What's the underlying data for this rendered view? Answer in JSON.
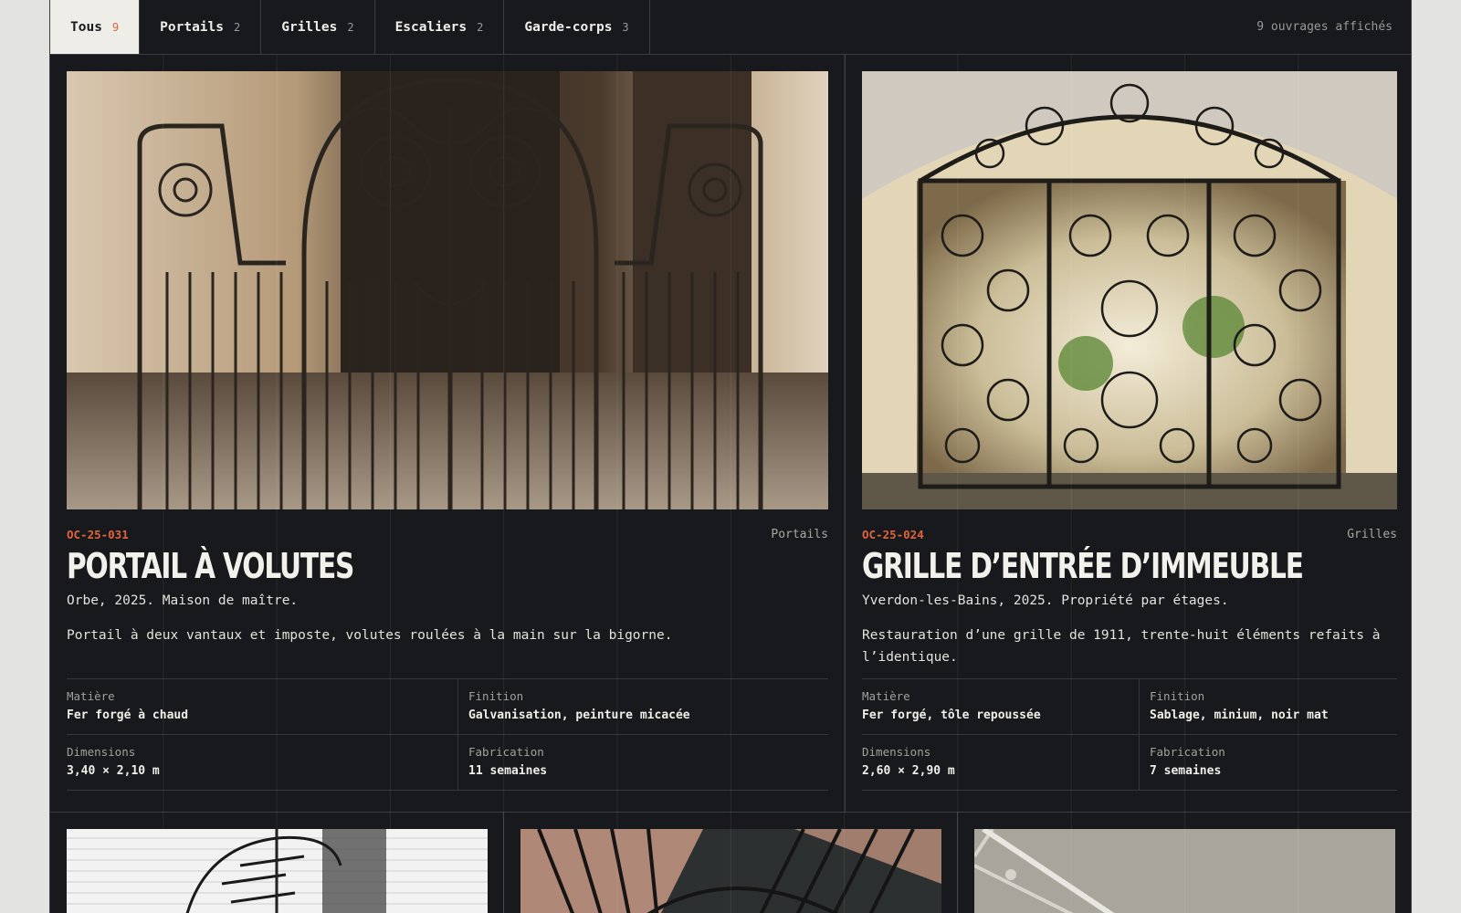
{
  "tabs": [
    {
      "label": "Tous",
      "count": "9",
      "active": true
    },
    {
      "label": "Portails",
      "count": "2"
    },
    {
      "label": "Grilles",
      "count": "2"
    },
    {
      "label": "Escaliers",
      "count": "2"
    },
    {
      "label": "Garde-corps",
      "count": "3"
    }
  ],
  "summary": "9 ouvrages affichés",
  "cards": [
    {
      "ref": "OC-25-031",
      "category": "Portails",
      "title": "PORTAIL À VOLUTES",
      "location": "Orbe, 2025. Maison de maître.",
      "description": "Portail à deux vantaux et imposte, volutes roulées à la main sur la bigorne.",
      "image": "wrought-iron-gate-photo",
      "specs": {
        "material_label": "Matière",
        "material": "Fer forgé à chaud",
        "finish_label": "Finition",
        "finish": "Galvanisation, peinture micacée",
        "dimensions_label": "Dimensions",
        "dimensions": "3,40 × 2,10 m",
        "fabrication_label": "Fabrication",
        "fabrication": "11 semaines"
      }
    },
    {
      "ref": "OC-25-024",
      "category": "Grilles",
      "title": "GRILLE D’ENTRÉE D’IMMEUBLE",
      "location": "Yverdon-les-Bains, 2025. Propriété par étages.",
      "description": "Restauration d’une grille de 1911, trente-huit éléments refaits à l’identique.",
      "image": "ornate-entrance-grille-photo",
      "specs": {
        "material_label": "Matière",
        "material": "Fer forgé, tôle repoussée",
        "finish_label": "Finition",
        "finish": "Sablage, minium, noir mat",
        "dimensions_label": "Dimensions",
        "dimensions": "2,60 × 2,90 m",
        "fabrication_label": "Fabrication",
        "fabrication": "7 semaines"
      }
    }
  ],
  "more_cards": [
    {
      "image": "spiral-staircase-photo"
    },
    {
      "image": "curved-railing-photo"
    },
    {
      "image": "concrete-handrail-photo"
    }
  ],
  "colors": {
    "background": "#17191c",
    "accent": "#e0653c",
    "active_tab": "#efede8"
  }
}
